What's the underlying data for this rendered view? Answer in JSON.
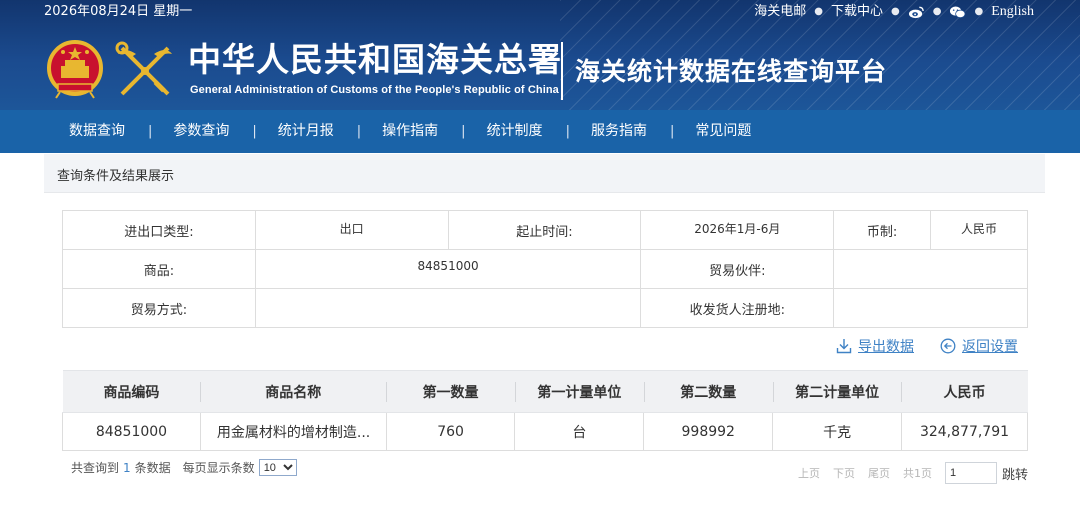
{
  "topbar": {
    "date": "2026年08月24日 星期一",
    "links": {
      "mail": "海关电邮",
      "download": "下载中心",
      "english": "English"
    }
  },
  "brand": {
    "name_cn": "中华人民共和国海关总署",
    "name_en": "General Administration of Customs of the People's Republic of China",
    "platform": "海关统计数据在线查询平台"
  },
  "nav": {
    "items": [
      {
        "label": "数据查询"
      },
      {
        "label": "参数查询"
      },
      {
        "label": "统计月报"
      },
      {
        "label": "操作指南"
      },
      {
        "label": "统计制度"
      },
      {
        "label": "服务指南"
      },
      {
        "label": "常见问题"
      }
    ],
    "separator": "|"
  },
  "section": {
    "title": "查询条件及结果展示"
  },
  "conditions": {
    "trade_type_label": "进出口类型:",
    "trade_type_value": "出口",
    "period_label": "起止时间:",
    "period_value": "2026年1月-6月",
    "currency_label": "币制:",
    "currency_value": "人民币",
    "goods_label": "商品:",
    "goods_value": "84851000",
    "partner_label": "贸易伙伴:",
    "partner_value": "",
    "trade_mode_label": "贸易方式:",
    "trade_mode_value": "",
    "consignee_label": "收发货人注册地:",
    "consignee_value": ""
  },
  "actions": {
    "export": "导出数据",
    "back": "返回设置"
  },
  "results": {
    "headers": [
      "商品编码",
      "商品名称",
      "第一数量",
      "第一计量单位",
      "第二数量",
      "第二计量单位",
      "人民币"
    ],
    "rows": [
      {
        "code": "84851000",
        "name": "用金属材料的增材制造...",
        "qty1": "760",
        "unit1": "台",
        "qty2": "998992",
        "unit2": "千克",
        "rmb": "324,877,791"
      }
    ]
  },
  "footer": {
    "total_prefix": "共查询到",
    "total_count": "1",
    "total_suffix": "条数据",
    "per_page_label": "每页显示条数",
    "per_page_value": "10",
    "pager": {
      "prev": "上页",
      "next": "下页",
      "last": "尾页",
      "total_pages": "共1页",
      "page_input": "1",
      "go": "跳转"
    }
  },
  "colors": {
    "header_dark": "#12356e",
    "nav": "#1a63a8",
    "link": "#3f82c5"
  }
}
